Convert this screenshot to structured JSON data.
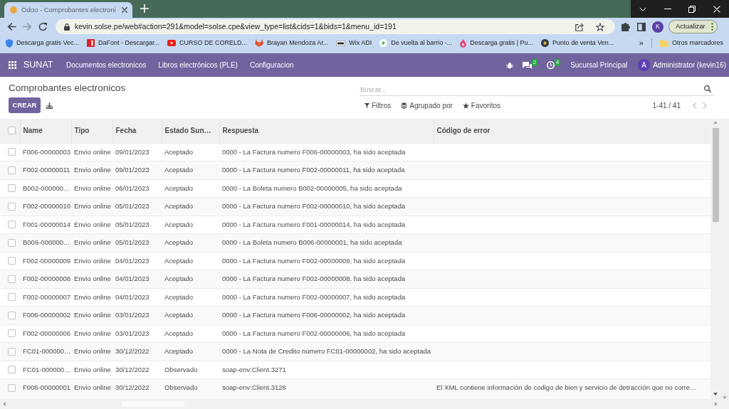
{
  "browser": {
    "tabs": [
      {
        "title": "Odoo - Comprobantes electroni",
        "selected": true
      }
    ],
    "nav": [
      {
        "kind": "back",
        "disabled": false
      },
      {
        "kind": "forward",
        "disabled": true
      },
      {
        "kind": "reload",
        "disabled": false
      }
    ],
    "url": "kevin.solse.pe/web#action=291&model=solse.cpe&view_type=list&cids=1&bids=1&menu_id=191",
    "profile": "K",
    "update_button": "Actualizar",
    "bookmarks": [
      {
        "kind": "shield",
        "label": "Descarga gratis Vec..."
      },
      {
        "kind": "tile",
        "label": "DaFont - Descargar..."
      },
      {
        "kind": "video",
        "label": "CURSO DE CORELD..."
      },
      {
        "kind": "fox",
        "label": "Brayan Mendoza Ar..."
      },
      {
        "kind": "wix",
        "label": "Wix ADI"
      },
      {
        "kind": "play",
        "label": "De vuelta al barrio -..."
      },
      {
        "kind": "drop",
        "label": "Descarga gratis | Pu..."
      },
      {
        "kind": "badge",
        "label": "Punto de venta Ven..."
      }
    ],
    "bookmarks_overflow": "»",
    "other_bookmarks": "Otros marcadores"
  },
  "navbar": {
    "app": "SUNAT",
    "menu": [
      "Documentos electronicos",
      "Libros electrónicos (PLE)",
      "Configuracion"
    ],
    "messages_count": "2",
    "activities_count": "4",
    "company": "Sucursal Principal",
    "user_initial": "A",
    "user": "Administrator (kevin16)"
  },
  "control_panel": {
    "title": "Comprobantes electronicos",
    "create_button": "CREAR",
    "search": {
      "placeholder": "Buscar..."
    },
    "search_options": [
      {
        "kind": "filter",
        "label": "Filtros"
      },
      {
        "kind": "group",
        "label": "Agrupado por"
      },
      {
        "kind": "favorite",
        "label": "Favoritos"
      }
    ],
    "pager": {
      "value": "1-41 / 41",
      "buttons": [
        {
          "kind": "previous",
          "disabled": true
        },
        {
          "kind": "next",
          "disabled": true
        }
      ]
    }
  },
  "table": {
    "header_checked": false,
    "columns": [
      "Name",
      "Tipo",
      "Fecha",
      "Estado Sun…",
      "Respuesta",
      "Código de error"
    ],
    "rows": [
      {
        "checked": false,
        "name": "F006-00000003",
        "tipo": "Envio online",
        "fecha": "09/01/2023",
        "estado": "Aceptado",
        "respuesta": "0000 - La Factura numero F006-00000003, ha sido aceptada"
      },
      {
        "checked": false,
        "name": "F002-00000011",
        "tipo": "Envio online",
        "fecha": "09/01/2023",
        "estado": "Aceptado",
        "respuesta": "0000 - La Factura numero F002-00000011, ha sido aceptada"
      },
      {
        "checked": false,
        "name": "B002-000000…",
        "tipo": "Envio online",
        "fecha": "06/01/2023",
        "estado": "Aceptado",
        "respuesta": "0000 - La Boleta numero B002-00000005, ha sido aceptada"
      },
      {
        "checked": false,
        "name": "F002-00000010",
        "tipo": "Envio online",
        "fecha": "05/01/2023",
        "estado": "Aceptado",
        "respuesta": "0000 - La Factura numero F002-00000010, ha sido aceptada"
      },
      {
        "checked": false,
        "name": "F001-00000014",
        "tipo": "Envio online",
        "fecha": "05/01/2023",
        "estado": "Aceptado",
        "respuesta": "0000 - La Factura numero F001-00000014, ha sido aceptada"
      },
      {
        "checked": false,
        "name": "B006-000000…",
        "tipo": "Envio online",
        "fecha": "05/01/2023",
        "estado": "Aceptado",
        "respuesta": "0000 - La Boleta numero B006-00000001, ha sido aceptada"
      },
      {
        "checked": false,
        "name": "F002-00000009",
        "tipo": "Envio online",
        "fecha": "04/01/2023",
        "estado": "Aceptado",
        "respuesta": "0000 - La Factura numero F002-00000009, ha sido aceptada"
      },
      {
        "checked": false,
        "name": "F002-00000008",
        "tipo": "Envio online",
        "fecha": "04/01/2023",
        "estado": "Aceptado",
        "respuesta": "0000 - La Factura numero F002-00000008, ha sido aceptada"
      },
      {
        "checked": false,
        "name": "F002-00000007",
        "tipo": "Envio online",
        "fecha": "04/01/2023",
        "estado": "Aceptado",
        "respuesta": "0000 - La Factura numero F002-00000007, ha sido aceptada"
      },
      {
        "checked": false,
        "name": "F006-00000002",
        "tipo": "Envio online",
        "fecha": "03/01/2023",
        "estado": "Aceptado",
        "respuesta": "0000 - La Factura numero F006-00000002, ha sido aceptada"
      },
      {
        "checked": false,
        "name": "F002-00000006",
        "tipo": "Envio online",
        "fecha": "03/01/2023",
        "estado": "Aceptado",
        "respuesta": "0000 - La Factura numero F002-00000006, ha sido aceptada"
      },
      {
        "checked": false,
        "name": "FC01-000000…",
        "tipo": "Envio online",
        "fecha": "30/12/2022",
        "estado": "Aceptado",
        "respuesta": "0000 - La Nota de Credito numero FC01-00000002, ha sido aceptada"
      },
      {
        "checked": false,
        "name": "FC01-000000…",
        "tipo": "Envio online",
        "fecha": "30/12/2022",
        "estado": "Observado",
        "respuesta": "soap-env:Client.3271"
      },
      {
        "checked": false,
        "name": "F006-00000001",
        "tipo": "Envio online",
        "fecha": "30/12/2022",
        "estado": "Observado",
        "respuesta": "soap-env:Client.3128",
        "codigo_error": "El XML contiene información de codigo de bien y servicio de detracción que no corre..."
      }
    ]
  }
}
